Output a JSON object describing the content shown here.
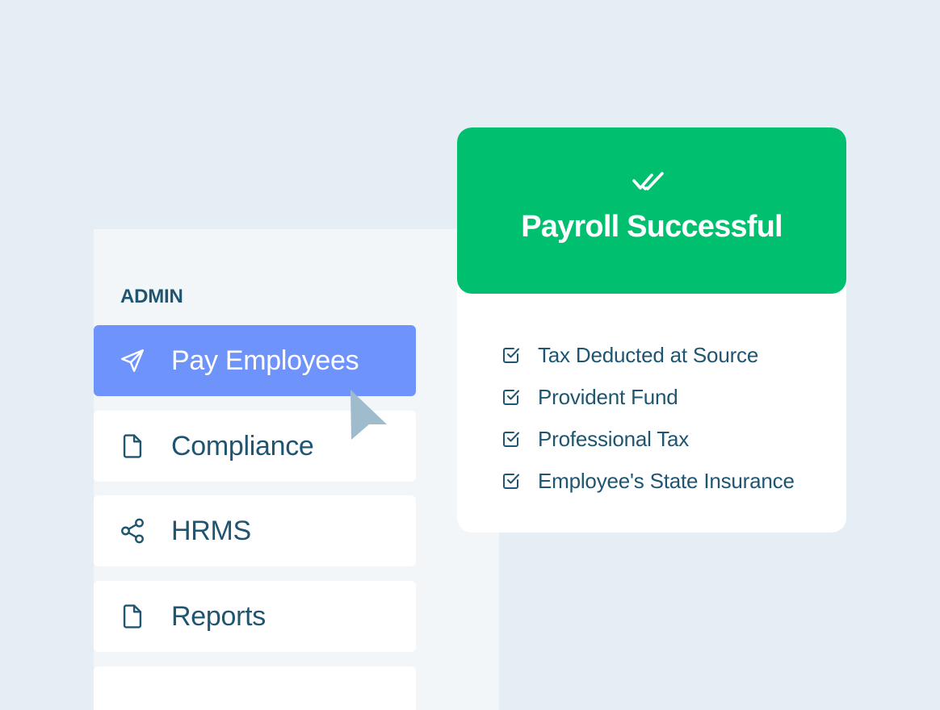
{
  "sidebar": {
    "section_label": "ADMIN",
    "items": [
      {
        "label": "Pay Employees",
        "icon": "send-icon",
        "active": true
      },
      {
        "label": "Compliance",
        "icon": "document-icon",
        "active": false
      },
      {
        "label": "HRMS",
        "icon": "share-icon",
        "active": false
      },
      {
        "label": "Reports",
        "icon": "document-icon",
        "active": false
      }
    ]
  },
  "payroll_card": {
    "title": "Payroll Successful",
    "header_icon": "double-check-icon",
    "checklist": [
      {
        "label": "Tax Deducted at Source"
      },
      {
        "label": "Provident Fund"
      },
      {
        "label": "Professional Tax"
      },
      {
        "label": "Employee's State Insurance"
      }
    ]
  },
  "colors": {
    "background": "#e6eef5",
    "sidebar_bg": "#f2f6f9",
    "accent_blue": "#6e94fb",
    "success_green": "#00bf6f",
    "text_primary": "#1f5570",
    "cursor": "#9fbccd"
  }
}
